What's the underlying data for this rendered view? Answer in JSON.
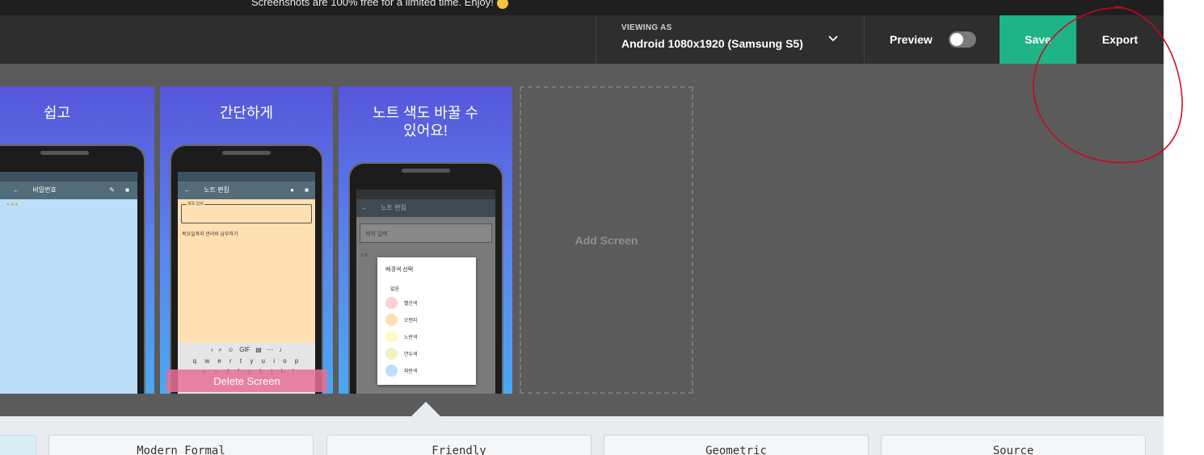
{
  "banner": {
    "text": "Screenshots are 100% free for a limited time. Enjoy!"
  },
  "toolbar": {
    "viewing_label": "VIEWING AS",
    "viewing_value": "Android 1080x1920 (Samsung S5)",
    "preview_label": "Preview",
    "preview_on": false,
    "save_label": "Save",
    "export_label": "Export"
  },
  "screens": [
    {
      "title": "쉽고",
      "app_title": "비밀번호"
    },
    {
      "title": "간단하게",
      "app_title": "노트 편집",
      "field_hint": "제목 입력",
      "body_text": "목요일까지 관리비 납부하기"
    },
    {
      "title": "노트 색도 바꿀 수 있어요!",
      "app_title": "노트 편집",
      "field_hint": "제목 입력",
      "body_prefix": "노트",
      "dialog": {
        "title": "배경색 선택",
        "options": [
          "없음",
          "빨간색",
          "오렌지",
          "노란색",
          "연두색",
          "파란색"
        ]
      }
    }
  ],
  "keyboard": {
    "row1": "q w e r t y u i o p",
    "row2": "a s d f g h j k l"
  },
  "add_screen_label": "Add Screen",
  "delete_screen_label": "Delete Screen",
  "styles": [
    "Modern Formal",
    "Friendly",
    "Geometric",
    "Source"
  ],
  "colors": {
    "save": "#1fb388",
    "toolbar": "#2e2e2e",
    "canvas": "#5b5b5b",
    "annotation": "#d0021b"
  }
}
